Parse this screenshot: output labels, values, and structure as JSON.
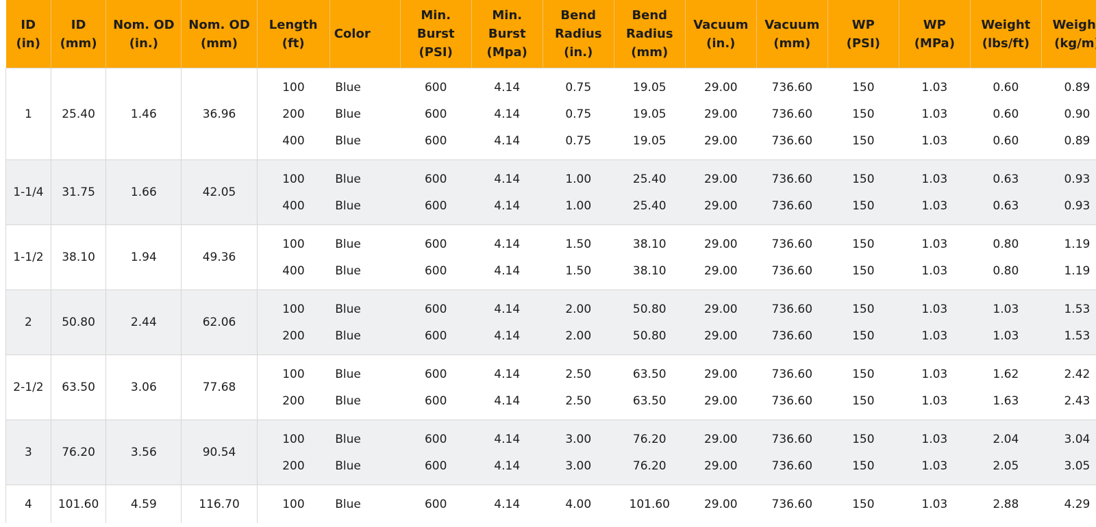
{
  "headers": [
    "ID\n(in)",
    "ID\n(mm)",
    "Nom. OD\n(in.)",
    "Nom. OD\n(mm)",
    "Length\n(ft)",
    "Color",
    "Min.\nBurst\n(PSI)",
    "Min.\nBurst\n(Mpa)",
    "Bend\nRadius\n(in.)",
    "Bend\nRadius\n(mm)",
    "Vacuum\n(in.)",
    "Vacuum\n(mm)",
    "WP\n(PSI)",
    "WP\n(MPa)",
    "Weight\n(lbs/ft)",
    "Weight\n(kg/m)"
  ],
  "groups": [
    {
      "id_in": "1",
      "id_mm": "25.40",
      "od_in": "1.46",
      "od_mm": "36.96",
      "rows": [
        [
          "100",
          "Blue",
          "600",
          "4.14",
          "0.75",
          "19.05",
          "29.00",
          "736.60",
          "150",
          "1.03",
          "0.60",
          "0.89"
        ],
        [
          "200",
          "Blue",
          "600",
          "4.14",
          "0.75",
          "19.05",
          "29.00",
          "736.60",
          "150",
          "1.03",
          "0.60",
          "0.90"
        ],
        [
          "400",
          "Blue",
          "600",
          "4.14",
          "0.75",
          "19.05",
          "29.00",
          "736.60",
          "150",
          "1.03",
          "0.60",
          "0.89"
        ]
      ]
    },
    {
      "id_in": "1-1/4",
      "id_mm": "31.75",
      "od_in": "1.66",
      "od_mm": "42.05",
      "rows": [
        [
          "100",
          "Blue",
          "600",
          "4.14",
          "1.00",
          "25.40",
          "29.00",
          "736.60",
          "150",
          "1.03",
          "0.63",
          "0.93"
        ],
        [
          "400",
          "Blue",
          "600",
          "4.14",
          "1.00",
          "25.40",
          "29.00",
          "736.60",
          "150",
          "1.03",
          "0.63",
          "0.93"
        ]
      ]
    },
    {
      "id_in": "1-1/2",
      "id_mm": "38.10",
      "od_in": "1.94",
      "od_mm": "49.36",
      "rows": [
        [
          "100",
          "Blue",
          "600",
          "4.14",
          "1.50",
          "38.10",
          "29.00",
          "736.60",
          "150",
          "1.03",
          "0.80",
          "1.19"
        ],
        [
          "400",
          "Blue",
          "600",
          "4.14",
          "1.50",
          "38.10",
          "29.00",
          "736.60",
          "150",
          "1.03",
          "0.80",
          "1.19"
        ]
      ]
    },
    {
      "id_in": "2",
      "id_mm": "50.80",
      "od_in": "2.44",
      "od_mm": "62.06",
      "rows": [
        [
          "100",
          "Blue",
          "600",
          "4.14",
          "2.00",
          "50.80",
          "29.00",
          "736.60",
          "150",
          "1.03",
          "1.03",
          "1.53"
        ],
        [
          "200",
          "Blue",
          "600",
          "4.14",
          "2.00",
          "50.80",
          "29.00",
          "736.60",
          "150",
          "1.03",
          "1.03",
          "1.53"
        ]
      ]
    },
    {
      "id_in": "2-1/2",
      "id_mm": "63.50",
      "od_in": "3.06",
      "od_mm": "77.68",
      "rows": [
        [
          "100",
          "Blue",
          "600",
          "4.14",
          "2.50",
          "63.50",
          "29.00",
          "736.60",
          "150",
          "1.03",
          "1.62",
          "2.42"
        ],
        [
          "200",
          "Blue",
          "600",
          "4.14",
          "2.50",
          "63.50",
          "29.00",
          "736.60",
          "150",
          "1.03",
          "1.63",
          "2.43"
        ]
      ]
    },
    {
      "id_in": "3",
      "id_mm": "76.20",
      "od_in": "3.56",
      "od_mm": "90.54",
      "rows": [
        [
          "100",
          "Blue",
          "600",
          "4.14",
          "3.00",
          "76.20",
          "29.00",
          "736.60",
          "150",
          "1.03",
          "2.04",
          "3.04"
        ],
        [
          "200",
          "Blue",
          "600",
          "4.14",
          "3.00",
          "76.20",
          "29.00",
          "736.60",
          "150",
          "1.03",
          "2.05",
          "3.05"
        ]
      ]
    },
    {
      "id_in": "4",
      "id_mm": "101.60",
      "od_in": "4.59",
      "od_mm": "116.70",
      "rows": [
        [
          "100",
          "Blue",
          "600",
          "4.14",
          "4.00",
          "101.60",
          "29.00",
          "736.60",
          "150",
          "1.03",
          "2.88",
          "4.29"
        ]
      ]
    }
  ],
  "colors": {
    "header_bg": "#fda500",
    "row_alt_bg": "#eff0f2",
    "text": "#1c1c1c",
    "border": "#d6d6d6"
  }
}
